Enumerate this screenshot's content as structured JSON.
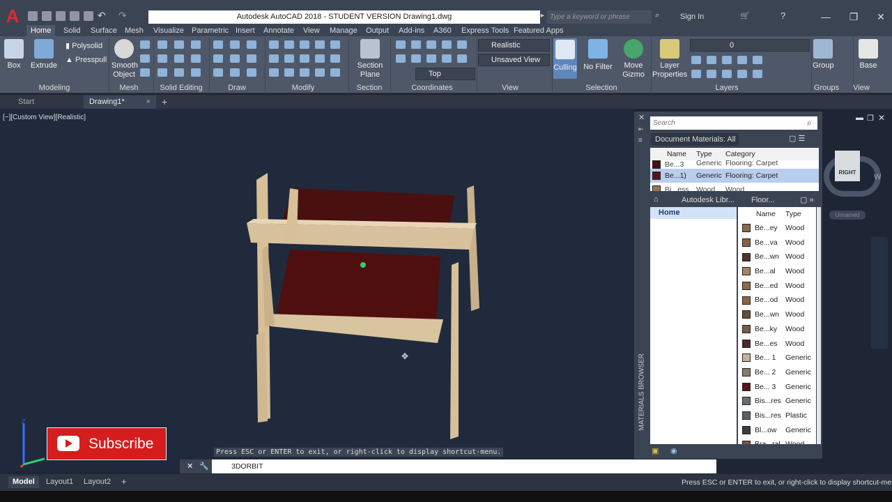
{
  "app": {
    "title": "Autodesk AutoCAD 2018 - STUDENT VERSION    Drawing1.dwg",
    "search_placeholder": "Type a keyword or phrase",
    "signin": "Sign In"
  },
  "ribbon_tabs": [
    "Home",
    "Solid",
    "Surface",
    "Mesh",
    "Visualize",
    "Parametric",
    "Insert",
    "Annotate",
    "View",
    "Manage",
    "Output",
    "Add-ins",
    "A360",
    "Express Tools",
    "Featured Apps"
  ],
  "ribbon": {
    "box": "Box",
    "extrude": "Extrude",
    "polysolid": "Polysolid",
    "presspull": "Presspull",
    "smooth_object": "Smooth Object",
    "section_plane": "Section Plane",
    "visual_style": "Realistic",
    "unsaved_view": "Unsaved View",
    "view_top": "Top",
    "culling": "Culling",
    "no_filter": "No Filter",
    "move_gizmo": "Move Gizmo",
    "layer_properties": "Layer Properties",
    "layer_name": "0",
    "group": "Group",
    "base": "Base",
    "panels": [
      "Modeling",
      "Mesh",
      "Solid Editing",
      "Draw",
      "Modify",
      "Section",
      "Coordinates",
      "View",
      "Selection",
      "Layers",
      "Groups",
      "View"
    ]
  },
  "doc_tabs": {
    "start": "Start",
    "drawing": "Drawing1*"
  },
  "viewport": {
    "label": "[−][Custom View][Realistic]",
    "viewcube_face": "RIGHT",
    "viewcube_unnamed": "Unnamed",
    "compass_w": "W",
    "axis_z": "Z"
  },
  "materials": {
    "side_title": "MATERIALS BROWSER",
    "search_placeholder": "Search",
    "doc_filter": "Document Materials: All",
    "doc_headers": [
      "Name",
      "Type",
      "Category"
    ],
    "doc_rows": [
      {
        "name": "Be...3",
        "type": "Generic",
        "category": "Flooring: Carpet",
        "color": "#4b1010"
      },
      {
        "name": "Be...1)",
        "type": "Generic",
        "category": "Flooring: Carpet",
        "color": "#5a1515"
      },
      {
        "name": "Bi...ess",
        "type": "Wood",
        "category": "Wood",
        "color": "#9b7654"
      }
    ],
    "library": "Autodesk Libr...",
    "floor": "Floor...",
    "home": "Home",
    "lib_headers": [
      "Name",
      "Type"
    ],
    "lib_rows": [
      {
        "name": "Be...ey",
        "type": "Wood",
        "color": "#8a6a4b"
      },
      {
        "name": "Be...va",
        "type": "Wood",
        "color": "#8a6040"
      },
      {
        "name": "Be...wn",
        "type": "Wood",
        "color": "#4a362c"
      },
      {
        "name": "Be...al",
        "type": "Wood",
        "color": "#a38563"
      },
      {
        "name": "Be...ed",
        "type": "Wood",
        "color": "#8f6a45"
      },
      {
        "name": "Be...od",
        "type": "Wood",
        "color": "#8d6440"
      },
      {
        "name": "Be...wn",
        "type": "Wood",
        "color": "#6b4a35"
      },
      {
        "name": "Be...ky",
        "type": "Wood",
        "color": "#7b5b46"
      },
      {
        "name": "Be...es",
        "type": "Wood",
        "color": "#4d2b2b"
      },
      {
        "name": "Be... 1",
        "type": "Generic",
        "color": "#c9b298"
      },
      {
        "name": "Be... 2",
        "type": "Generic",
        "color": "#8a7a68"
      },
      {
        "name": "Be... 3",
        "type": "Generic",
        "color": "#5a1515"
      },
      {
        "name": "Bis...res",
        "type": "Generic",
        "color": "#6b6e72"
      },
      {
        "name": "Bis...res",
        "type": "Plastic",
        "color": "#5c6066"
      },
      {
        "name": "Bl...ow",
        "type": "Generic",
        "color": "#3a3c44"
      },
      {
        "name": "Bra...ral",
        "type": "Wood",
        "color": "#7a5640"
      }
    ]
  },
  "command": {
    "message": "Press ESC or ENTER to exit, or right-click to display shortcut-menu.",
    "current": "3DORBIT"
  },
  "status": {
    "tabs": [
      "Model",
      "Layout1",
      "Layout2"
    ],
    "message": "Press ESC or ENTER to exit, or right-click to display shortcut-menu"
  },
  "overlay": {
    "subscribe": "Subscribe"
  }
}
